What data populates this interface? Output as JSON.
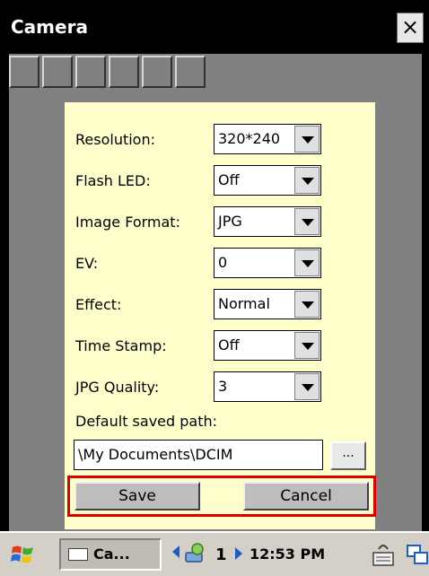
{
  "window": {
    "title": "Camera",
    "close_label": "×"
  },
  "settings": [
    {
      "label": "Resolution:",
      "value": "320*240"
    },
    {
      "label": "Flash LED:",
      "value": "Off"
    },
    {
      "label": "Image Format:",
      "value": "JPG"
    },
    {
      "label": "EV:",
      "value": "0"
    },
    {
      "label": "Effect:",
      "value": "Normal"
    },
    {
      "label": "Time Stamp:",
      "value": "Off"
    },
    {
      "label": "JPG Quality:",
      "value": "3"
    }
  ],
  "path": {
    "label": "Default saved path:",
    "value": "\\My Documents\\DCIM",
    "browse_label": "..."
  },
  "buttons": {
    "save": "Save",
    "cancel": "Cancel"
  },
  "taskbar": {
    "task_label": "Ca...",
    "page_number": "1",
    "clock": "12:53 PM"
  },
  "colors": {
    "panel": "#ffffcc",
    "highlight": "#dd0000",
    "client": "#808080"
  }
}
